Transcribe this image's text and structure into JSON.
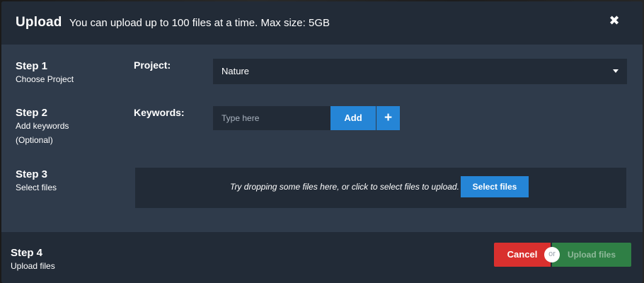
{
  "header": {
    "title": "Upload",
    "subtitle": "You can upload up to 100 files at a time. Max size: 5GB",
    "close_icon": "✖"
  },
  "steps": [
    {
      "title": "Step 1",
      "sub1": "Choose Project",
      "sub2": ""
    },
    {
      "title": "Step 2",
      "sub1": "Add keywords",
      "sub2": "(Optional)"
    },
    {
      "title": "Step 3",
      "sub1": "Select files",
      "sub2": ""
    },
    {
      "title": "Step 4",
      "sub1": "Upload files",
      "sub2": ""
    }
  ],
  "project": {
    "label": "Project:",
    "selected": "Nature"
  },
  "keywords": {
    "label": "Keywords:",
    "placeholder": "Type here",
    "add_label": "Add",
    "plus_icon": "+"
  },
  "dropzone": {
    "hint": "Try dropping some files here, or click to select files to upload.",
    "button_label": "Select files"
  },
  "footer": {
    "cancel_label": "Cancel",
    "or_label": "or",
    "upload_label": "Upload files"
  },
  "colors": {
    "accent_blue": "#2585d6",
    "danger_red": "#d9302e",
    "success_green": "#2f7f45",
    "panel_dark": "#222b37",
    "panel_body": "#2f3b4b"
  }
}
